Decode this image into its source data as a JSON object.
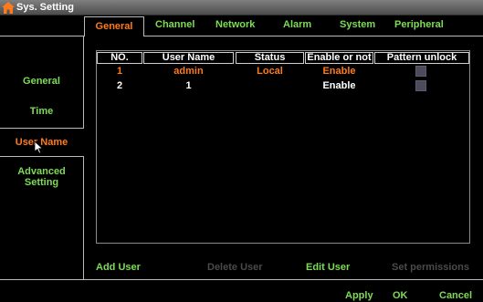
{
  "window": {
    "title": "Sys. Setting",
    "icon": "home-icon"
  },
  "tabs": [
    {
      "label": "General",
      "active": true
    },
    {
      "label": "Channel"
    },
    {
      "label": "Network"
    },
    {
      "label": "Alarm"
    },
    {
      "label": "System"
    },
    {
      "label": "Peripheral"
    }
  ],
  "sidebar": {
    "items": [
      {
        "label": "General"
      },
      {
        "label": "Time"
      },
      {
        "label": "User Name",
        "active": true
      },
      {
        "label": "Advanced Setting"
      }
    ]
  },
  "table": {
    "headers": [
      "NO.",
      "User Name",
      "Status",
      "Enable or not",
      "Pattern unlock"
    ],
    "rows": [
      {
        "no": "1",
        "user": "admin",
        "status": "Local",
        "enable": "Enable",
        "pattern_unlock": false
      },
      {
        "no": "2",
        "user": "1",
        "status": "",
        "enable": "Enable",
        "pattern_unlock": false
      }
    ]
  },
  "actions": {
    "add_user": "Add User",
    "delete_user": "Delete User",
    "edit_user": "Edit User",
    "set_permissions": "Set permissions"
  },
  "footer": {
    "apply": "Apply",
    "ok": "OK",
    "cancel": "Cancel"
  },
  "colors": {
    "accent": "#ff7a1a",
    "link": "#7ddc55",
    "disabled": "#4a4a4a",
    "background": "#000000"
  }
}
